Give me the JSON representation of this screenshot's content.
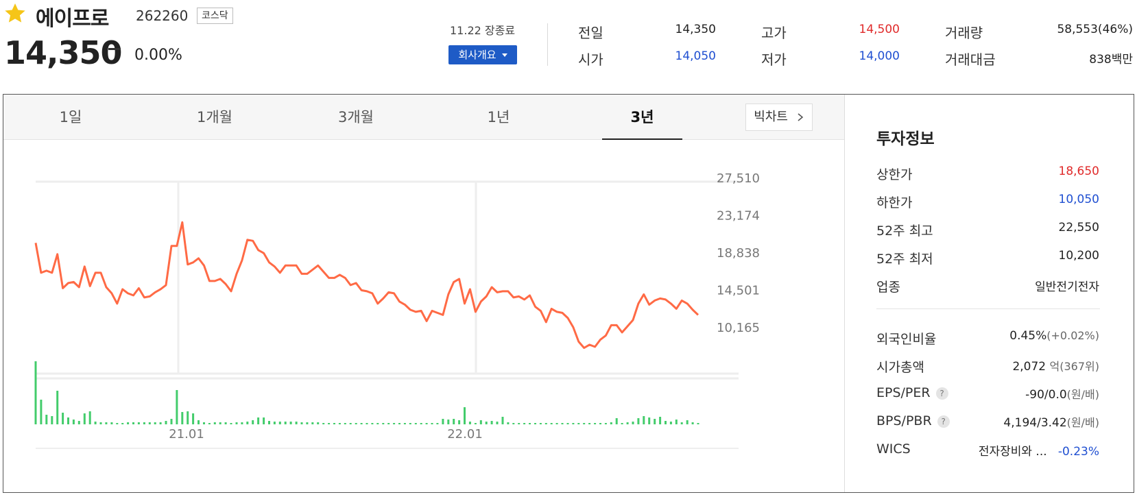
{
  "header": {
    "stock_name": "에이프로",
    "stock_code": "262260",
    "market": "코스닥",
    "price": "14,350",
    "change": "0.00%",
    "close_status": "11.22 장종료",
    "company_button": "회사개요"
  },
  "quote": {
    "prev_close": {
      "label": "전일",
      "value": "14,350"
    },
    "open": {
      "label": "시가",
      "value": "14,050"
    },
    "high": {
      "label": "고가",
      "value": "14,500"
    },
    "low": {
      "label": "저가",
      "value": "14,000"
    },
    "volume": {
      "label": "거래량",
      "value": "58,553(46%)"
    },
    "trade_value": {
      "label": "거래대금",
      "value": "838백만"
    }
  },
  "chart_tabs": [
    "1일",
    "1개월",
    "3개월",
    "1년",
    "3년"
  ],
  "active_tab": "3년",
  "bigchart_label": "빅차트",
  "colors": {
    "price_line": "#ff6a45",
    "volume_bar": "#43cc6b",
    "up": "#e02a2a",
    "down": "#1f4fd1",
    "accent": "#1e5bc6"
  },
  "chart_data": {
    "type": "line",
    "y_ticks": [
      "27,510",
      "23,174",
      "18,838",
      "14,501",
      "10,165"
    ],
    "x_ticks": [
      "21.01",
      "22.01"
    ],
    "ylim": [
      10165,
      27510
    ],
    "price": [
      22200,
      19300,
      19500,
      19300,
      21100,
      17800,
      18300,
      18400,
      17900,
      19900,
      18000,
      19300,
      19300,
      17900,
      17300,
      16300,
      17700,
      17300,
      17100,
      17800,
      16900,
      17000,
      17400,
      17700,
      18100,
      21900,
      21900,
      24200,
      20100,
      20300,
      20700,
      20000,
      18500,
      18500,
      18700,
      18200,
      17500,
      19200,
      20500,
      22500,
      22400,
      21500,
      21200,
      20300,
      19900,
      19300,
      20000,
      20000,
      20000,
      19200,
      19200,
      19600,
      20000,
      19400,
      18800,
      18800,
      19100,
      18800,
      18100,
      18300,
      17600,
      17500,
      17300,
      16300,
      16800,
      17400,
      17300,
      16500,
      16200,
      15700,
      15500,
      15600,
      14600,
      15600,
      15400,
      15200,
      17200,
      18400,
      18700,
      16300,
      17700,
      15500,
      16500,
      17000,
      17900,
      17400,
      17500,
      17500,
      16900,
      17000,
      16700,
      17100,
      16000,
      15600,
      14500,
      15800,
      15500,
      15400,
      14900,
      14000,
      12600,
      12000,
      12300,
      12100,
      12800,
      13200,
      14200,
      14200,
      13500,
      14100,
      14700,
      16300,
      17200,
      16200,
      16600,
      16800,
      16700,
      16300,
      15800,
      16600,
      16300,
      15700,
      15200
    ]
  },
  "volume_data": {
    "values": [
      92,
      36,
      14,
      12,
      49,
      17,
      10,
      7,
      5,
      16,
      19,
      4,
      3,
      3,
      3,
      2,
      2,
      3,
      3,
      3,
      3,
      3,
      3,
      3,
      5,
      8,
      50,
      18,
      19,
      16,
      6,
      3,
      2,
      3,
      3,
      3,
      2,
      3,
      3,
      4,
      6,
      10,
      10,
      5,
      4,
      4,
      4,
      4,
      4,
      3,
      3,
      3,
      3,
      2,
      2,
      2,
      2,
      2,
      2,
      2,
      2,
      2,
      2,
      2,
      2,
      2,
      2,
      2,
      2,
      2,
      2,
      2,
      2,
      2,
      2,
      8,
      7,
      8,
      6,
      25,
      4,
      2,
      6,
      4,
      5,
      4,
      11,
      3,
      2,
      2,
      2,
      2,
      2,
      2,
      2,
      2,
      2,
      2,
      2,
      2,
      2,
      2,
      2,
      2,
      2,
      2,
      3,
      9,
      2,
      3,
      4,
      9,
      12,
      10,
      8,
      11,
      5,
      4,
      7,
      3,
      6,
      3,
      2
    ]
  },
  "investment_info": {
    "title": "투자정보",
    "rows": [
      {
        "label": "상한가",
        "value": "18,650"
      },
      {
        "label": "하한가",
        "value": "10,050"
      },
      {
        "label": "52주 최고",
        "value": "22,550"
      },
      {
        "label": "52주 최저",
        "value": "10,200"
      },
      {
        "label": "업종",
        "value": "일반전기전자"
      }
    ],
    "foreign_ratio": {
      "label": "외국인비율",
      "value": "0.45%",
      "sub": "(+0.02%)"
    },
    "market_cap": {
      "label": "시가총액",
      "value": "2,072",
      "sub": "억(367위)"
    },
    "eps_per": {
      "label": "EPS/PER",
      "value": "-90/0.0",
      "sub": "(원/배)"
    },
    "bps_pbr": {
      "label": "BPS/PBR",
      "value": "4,194/3.42",
      "sub": "(원/배)"
    },
    "wics": {
      "label": "WICS",
      "value": "전자장비와 ...",
      "change": "-0.23%"
    }
  }
}
